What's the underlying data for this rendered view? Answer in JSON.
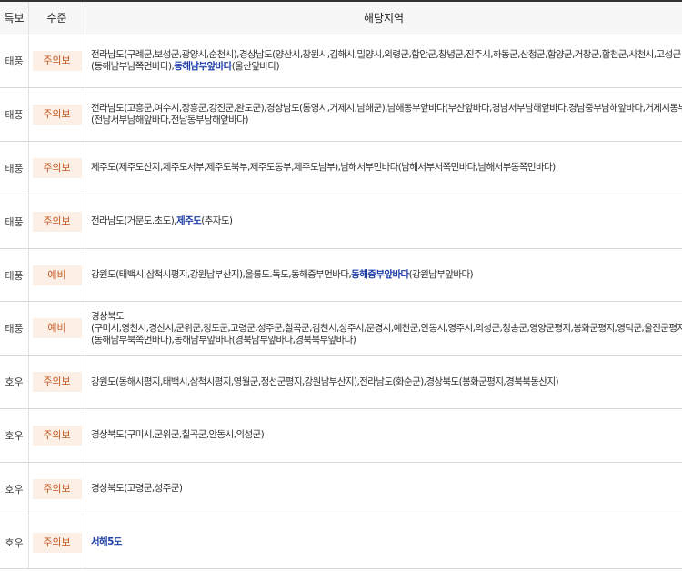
{
  "header": {
    "type": "특보",
    "level": "수준",
    "area": "해당지역"
  },
  "rows": [
    {
      "type": "태풍",
      "level": "주의보",
      "l1": "전라남도(구례군,보성군,광양시,순천시),경상남도(양산시,창원시,김해시,밀양시,의령군,함안군,창녕군,진주시,하동군,산청군,함양군,거창군,합천군,사천시,고성군",
      "l2a": "(동해남부남쪽먼바다),",
      "l2b": "동해남부앞바다",
      "l2c": "(울산앞바다)"
    },
    {
      "type": "태풍",
      "level": "주의보",
      "l1": "전라남도(고흥군,여수시,장흥군,강진군,완도군),경상남도(통영시,거제시,남해군),남해동부앞바다(부산앞바다,경남서부남해앞바다,경남중부남해앞바다,거제시동부",
      "l2": "(전남서부남해앞바다,전남동부남해앞바다)"
    },
    {
      "type": "태풍",
      "level": "주의보",
      "l1": "제주도(제주도산지,제주도서부,제주도북부,제주도동부,제주도남부),남해서부먼바다(남해서부서쪽먼바다,남해서부동쪽먼바다)"
    },
    {
      "type": "태풍",
      "level": "주의보",
      "l1a": "전라남도(거문도.초도),",
      "l1b": "제주도",
      "l1c": "(추자도)"
    },
    {
      "type": "태풍",
      "level": "예비",
      "l1a": "강원도(태백시,삼척시평지,강원남부산지),울릉도.독도,동해중부먼바다,",
      "l1b": "동해중부앞바다",
      "l1c": "(강원남부앞바다)"
    },
    {
      "type": "태풍",
      "level": "예비",
      "l1": "경상북도",
      "l2": "(구미시,영천시,경산시,군위군,청도군,고령군,성주군,칠곡군,김천시,상주시,문경시,예천군,안동시,영주시,의성군,청송군,영양군평지,봉화군평지,영덕군,울진군평지",
      "l3": "(동해남부북쪽먼바다),동해남부앞바다(경북남부앞바다,경북북부앞바다)"
    },
    {
      "type": "호우",
      "level": "주의보",
      "l1": "강원도(동해시평지,태백시,삼척시평지,영월군,정선군평지,강원남부산지),전라남도(화순군),경상북도(봉화군평지,경북북동산지)"
    },
    {
      "type": "호우",
      "level": "주의보",
      "l1": "경상북도(구미시,군위군,칠곡군,안동시,의성군)"
    },
    {
      "type": "호우",
      "level": "주의보",
      "l1": "경상북도(고령군,성주군)"
    },
    {
      "type": "호우",
      "level": "주의보",
      "l1": "서해5도"
    }
  ]
}
